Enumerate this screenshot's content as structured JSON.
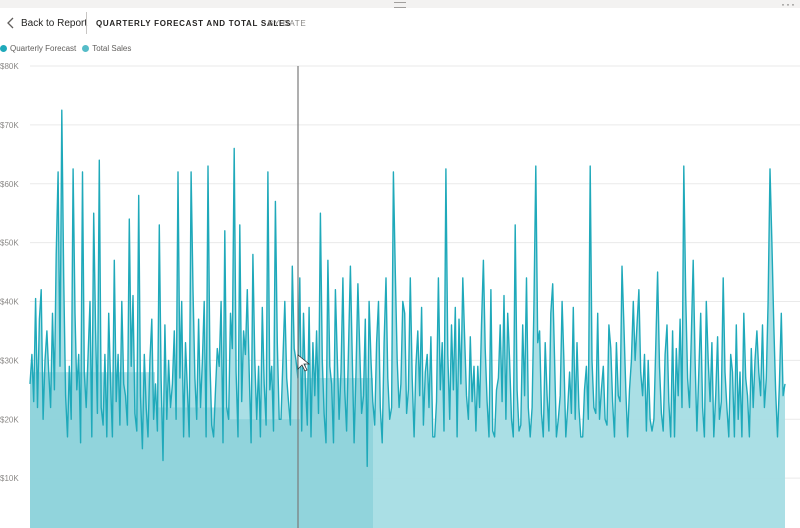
{
  "header": {
    "back_label": "Back to Report",
    "title": "QUARTERLY FORECAST AND TOTAL SALES",
    "subtitle": "BY DATE"
  },
  "colors": {
    "forecast": "#37b3c2",
    "sales": "#a5dde4",
    "sales_dark": "#7bcbd6",
    "line": "#1fa9ba"
  },
  "chart_data": {
    "type": "area",
    "legend": [
      {
        "name": "Quarterly Forecast",
        "color": "#1fa9ba"
      },
      {
        "name": "Total Sales",
        "color": "#55bcc8"
      }
    ],
    "legend_position": "top-left",
    "y_ticks": [
      "$10K",
      "$20K",
      "$30K",
      "$40K",
      "$50K",
      "$60K",
      "$70K",
      "$80K"
    ],
    "ylim": [
      0,
      80000
    ],
    "grid": true,
    "series": [
      {
        "name": "Total Sales",
        "values": [
          26000,
          31000,
          23000,
          40500,
          22000,
          37000,
          42000,
          20000,
          30000,
          35000,
          28000,
          22000,
          38000,
          25000,
          48000,
          62000,
          29000,
          72500,
          44000,
          24000,
          17000,
          29000,
          20000,
          62500,
          38000,
          25000,
          31000,
          16000,
          62000,
          28000,
          22000,
          31000,
          40000,
          17000,
          55000,
          35000,
          21000,
          64000,
          22000,
          19000,
          31000,
          17000,
          38000,
          26000,
          17000,
          47000,
          23000,
          31000,
          19000,
          40000,
          26000,
          24000,
          19000,
          54000,
          29000,
          41000,
          21000,
          18000,
          58000,
          24000,
          15000,
          31000,
          22000,
          17000,
          30000,
          37000,
          20000,
          26000,
          18000,
          53000,
          27000,
          13000,
          36000,
          20000,
          30000,
          22000,
          26000,
          35000,
          20000,
          62000,
          27000,
          40000,
          17000,
          33000,
          25000,
          17000,
          62000,
          42000,
          27000,
          20000,
          37000,
          22000,
          30000,
          40000,
          17000,
          63000,
          30000,
          19000,
          17000,
          25000,
          32000,
          29000,
          40000,
          16000,
          52000,
          22000,
          20000,
          38000,
          32000,
          66000,
          28000,
          17000,
          53000,
          23000,
          35000,
          31000,
          42000,
          28000,
          16000,
          48000,
          30000,
          20000,
          29000,
          17000,
          39000,
          26000,
          19000,
          62000,
          25000,
          29000,
          18000,
          57000,
          33000,
          20000,
          20000,
          30000,
          40000,
          27000,
          23000,
          19000,
          46000,
          32000,
          30000,
          27000,
          44000,
          18000,
          38000,
          26000,
          19000,
          39000,
          17000,
          33000,
          24000,
          35000,
          21000,
          55000,
          30000,
          21000,
          16000,
          47000,
          29000,
          26000,
          16000,
          42000,
          31000,
          20000,
          28000,
          44000,
          25000,
          18000,
          32000,
          46000,
          31000,
          16000,
          28000,
          43000,
          32000,
          21000,
          24000,
          37000,
          12000,
          40000,
          30000,
          23000,
          19000,
          33000,
          40000,
          22000,
          16000,
          33000,
          44000,
          27000,
          20000,
          22000,
          62000,
          45000,
          30000,
          22000,
          26000,
          40000,
          38000,
          21000,
          25000,
          44000,
          27000,
          17000,
          29000,
          35000,
          24000,
          39000,
          19000,
          28000,
          31000,
          22000,
          34000,
          17000,
          17000,
          23000,
          44000,
          25000,
          33000,
          18000,
          62500,
          31000,
          20000,
          36000,
          25000,
          39000,
          17000,
          37000,
          26000,
          44000,
          34000,
          24000,
          20000,
          34000,
          23000,
          29000,
          18000,
          29000,
          22000,
          36000,
          47000,
          32000,
          23000,
          17000,
          42000,
          18000,
          17000,
          25000,
          27000,
          36000,
          23000,
          41000,
          20000,
          38000,
          30000,
          20000,
          17000,
          53000,
          25000,
          18000,
          19000,
          36000,
          24000,
          44000,
          22000,
          17000,
          22000,
          40000,
          63000,
          33000,
          35000,
          21000,
          17000,
          33000,
          24000,
          18000,
          38000,
          43000,
          30000,
          17000,
          20000,
          24000,
          40000,
          30000,
          17000,
          22000,
          28000,
          21000,
          39000,
          20000,
          33000,
          22000,
          17000,
          17000,
          25000,
          29000,
          20000,
          63000,
          30000,
          22000,
          21000,
          38000,
          20000,
          25000,
          29000,
          20000,
          19000,
          36000,
          32000,
          23000,
          17000,
          33000,
          24000,
          23000,
          46000,
          36000,
          25000,
          17000,
          25000,
          30000,
          40000,
          30000,
          36000,
          42000,
          28000,
          24000,
          31000,
          18000,
          30000,
          20000,
          18000,
          20000,
          32000,
          45000,
          29000,
          21000,
          18000,
          31000,
          36000,
          23000,
          17000,
          35000,
          17000,
          32000,
          24000,
          37000,
          22000,
          63000,
          41000,
          27000,
          22000,
          34000,
          47000,
          30000,
          18000,
          28000,
          38000,
          22000,
          17000,
          40000,
          30000,
          23000,
          33000,
          17000,
          24000,
          34000,
          20000,
          23000,
          44000,
          28000,
          22000,
          17000,
          31000,
          28000,
          17000,
          36000,
          20000,
          28000,
          17000,
          38000,
          27000,
          24000,
          17000,
          32000,
          22000,
          30000,
          35000,
          28000,
          24000,
          36000,
          22000,
          27000,
          40000,
          62500,
          50000,
          36000,
          25000,
          17000,
          26000,
          38000,
          24000,
          26000
        ]
      }
    ]
  }
}
